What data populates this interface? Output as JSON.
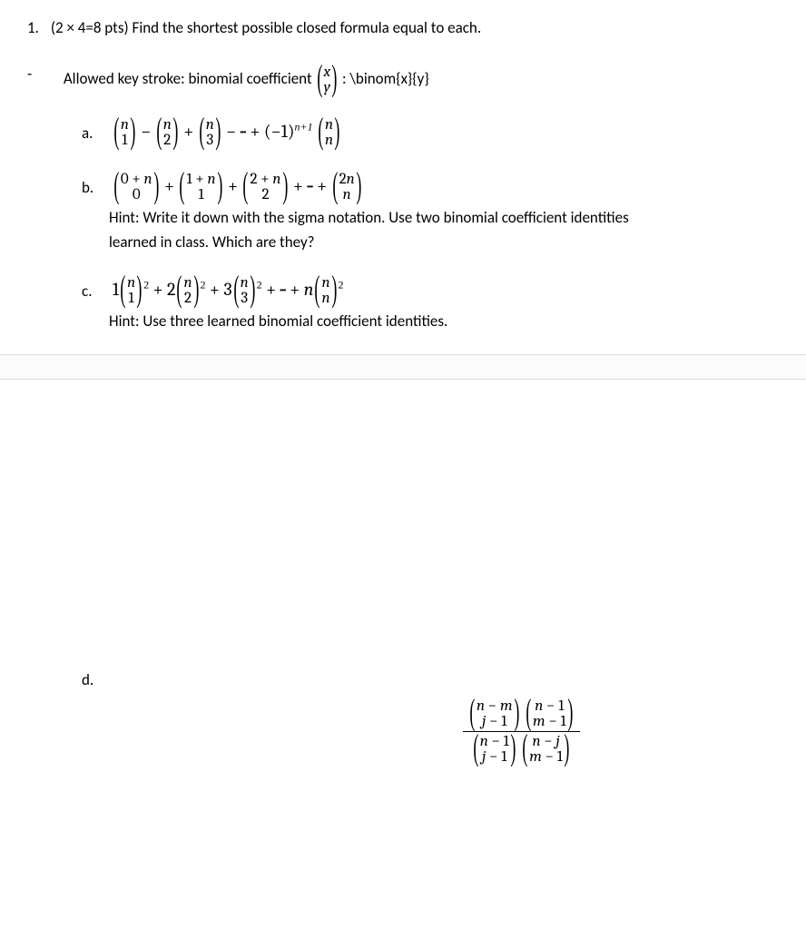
{
  "question": {
    "number": "1.",
    "points_text": "(2 × 4=8 pts) Find the shortest possible closed formula equal to each."
  },
  "allowed": {
    "bullet": "-",
    "prefix": "Allowed key stroke:   binomial coefficient ",
    "binom_top": "x",
    "binom_bot": "y",
    "colon": "  :  ",
    "latex_cmd": "\\binom{x}{y}"
  },
  "parts": {
    "a": {
      "label": "a.",
      "expr_html": "<span class='binom-pad'><span class='binom'><span class='top italic'>n</span><span class='bot'>1</span></span></span> − <span class='binom-pad'><span class='binom'><span class='top italic'>n</span><span class='bot'>2</span></span></span> + <span class='binom-pad'><span class='binom'><span class='top italic'>n</span><span class='bot'>3</span></span></span> − ··· + (−1)<span class='sup italic'>n+1</span> <span class='binom-pad'><span class='binom'><span class='top italic'>n</span><span class='bot italic'>n</span></span></span>"
    },
    "b": {
      "label": "b.",
      "expr_html": "<span class='binom-pad'><span class='binom'><span class='top'>0 + <span class=\"italic\">n</span></span><span class='bot'>0</span></span></span> + <span class='binom-pad'><span class='binom'><span class='top'>1 + <span class=\"italic\">n</span></span><span class='bot'>1</span></span></span> + <span class='binom-pad'><span class='binom'><span class='top'>2 + <span class=\"italic\">n</span></span><span class='bot'>2</span></span></span> + ··· + <span class='binom-pad'><span class='binom'><span class='top'>2<span class=\"italic\">n</span></span><span class='bot italic'>n</span></span></span>",
      "hint1": "Hint: Write it down with the sigma notation. Use two binomial coefficient identities",
      "hint2": "learned in class. Which are they?"
    },
    "c": {
      "label": "c.",
      "expr_html": "1<span class='binom-pad'><span class='binom'><span class='top italic'>n</span><span class='bot'>1</span></span></span><span class='sup'>2</span> + 2<span class='binom-pad'><span class='binom'><span class='top italic'>n</span><span class='bot'>2</span></span></span><span class='sup'>2</span> + 3<span class='binom-pad'><span class='binom'><span class='top italic'>n</span><span class='bot'>3</span></span></span><span class='sup'>2</span> + ··· + <span class='italic'>n</span><span class='binom-pad'><span class='binom'><span class='top italic'>n</span><span class='bot italic'>n</span></span></span><span class='sup'>2</span>",
      "hint": "Hint: Use three learned binomial coefficient identities."
    },
    "d": {
      "label": "d.",
      "frac_num_html": "<span class='binom-pad'><span class='binom'><span class='top'><span class=\"italic\">n</span> − <span class=\"italic\">m</span></span><span class='bot'><span class=\"italic\">j</span> − 1</span></span></span> <span class='binom-pad'><span class='binom'><span class='top'><span class=\"italic\">n</span> − 1</span><span class='bot'><span class=\"italic\">m</span> − 1</span></span></span>",
      "frac_den_html": "<span class='binom-pad'><span class='binom'><span class='top'><span class=\"italic\">n</span> − 1</span><span class='bot'><span class=\"italic\">j</span> − 1</span></span></span> <span class='binom-pad'><span class='binom'><span class='top'><span class=\"italic\">n</span> − <span class=\"italic\">j</span></span><span class='bot'><span class=\"italic\">m</span> − 1</span></span></span>"
    }
  }
}
